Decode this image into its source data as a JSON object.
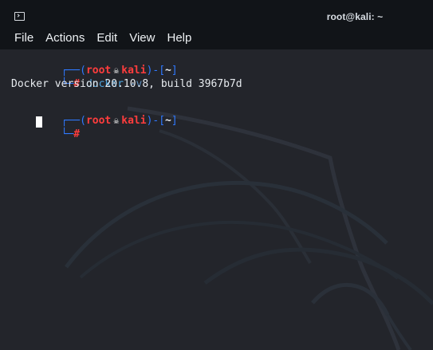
{
  "title_bar": {
    "title": "root@kali: ~",
    "icon": "terminal-icon"
  },
  "menu": {
    "items": [
      "File",
      "Actions",
      "Edit",
      "View",
      "Help"
    ]
  },
  "terminal": {
    "prompt_user": "root",
    "prompt_host": "kali",
    "prompt_path": "~",
    "command": "docker",
    "argument": "-v",
    "output": "Docker version 20.10.8, build 3967b7d",
    "second_prompt_user": "root",
    "second_prompt_host": "kali",
    "second_prompt_path": "~"
  },
  "colors": {
    "background": "#23252b",
    "accent_blue": "#2f79ff",
    "root_red": "#ff3d3d",
    "command_blue": "#4ca4df"
  }
}
